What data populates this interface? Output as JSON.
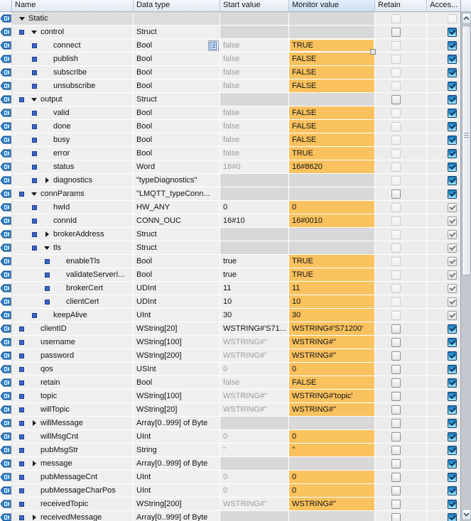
{
  "columns": {
    "name": "Name",
    "data_type": "Data type",
    "start_value": "Start value",
    "monitor_value": "Monitor value",
    "retain": "Retain",
    "access": "Acces..."
  },
  "colors": {
    "monitor_highlight": "#f9c25e",
    "struct_cell_grey": "#d8d8d8",
    "row_bg": "#efefef",
    "static_row_bg": "#dcdcdc",
    "header_bg": "#e9eff7",
    "monitor_header_bg": "#d3e2f4",
    "access_checkbox_blue": "#41a9e0",
    "bullet_blue": "#3a64c8",
    "dim_text": "#9c9c9c"
  },
  "icons": {
    "row_icon": "db-variable-tag-icon",
    "type_button_icon": "list-picker-icon",
    "expander_open": "triangle-down",
    "expander_closed": "triangle-right"
  },
  "rows": [
    {
      "name": "Static",
      "level": 0,
      "bullet": false,
      "expander": "down",
      "type": "",
      "start": null,
      "start_grey": false,
      "monitor": null,
      "retain": "disabled",
      "access": "none",
      "static_row": true,
      "selected": false,
      "type_button": false
    },
    {
      "name": "control",
      "level": 1,
      "bullet": true,
      "expander": "down",
      "type": "Struct",
      "start": null,
      "start_grey": false,
      "monitor": null,
      "retain": "enabled",
      "access": "blue",
      "static_row": false,
      "selected": false,
      "type_button": false
    },
    {
      "name": "connect",
      "level": 2,
      "bullet": true,
      "expander": null,
      "type": "Bool",
      "start": "false",
      "start_grey": true,
      "monitor": "TRUE",
      "retain": "disabled",
      "access": "blue",
      "static_row": false,
      "selected": true,
      "type_button": true
    },
    {
      "name": "publish",
      "level": 2,
      "bullet": true,
      "expander": null,
      "type": "Bool",
      "start": "false",
      "start_grey": true,
      "monitor": "FALSE",
      "retain": "disabled",
      "access": "blue",
      "static_row": false,
      "selected": false,
      "type_button": false
    },
    {
      "name": "subscribe",
      "level": 2,
      "bullet": true,
      "expander": null,
      "type": "Bool",
      "start": "false",
      "start_grey": true,
      "monitor": "FALSE",
      "retain": "disabled",
      "access": "blue",
      "static_row": false,
      "selected": false,
      "type_button": false
    },
    {
      "name": "unsubscribe",
      "level": 2,
      "bullet": true,
      "expander": null,
      "type": "Bool",
      "start": "false",
      "start_grey": true,
      "monitor": "FALSE",
      "retain": "disabled",
      "access": "blue",
      "static_row": false,
      "selected": false,
      "type_button": false
    },
    {
      "name": "output",
      "level": 1,
      "bullet": true,
      "expander": "down",
      "type": "Struct",
      "start": null,
      "start_grey": false,
      "monitor": null,
      "retain": "enabled",
      "access": "blue",
      "static_row": false,
      "selected": false,
      "type_button": false
    },
    {
      "name": "valid",
      "level": 2,
      "bullet": true,
      "expander": null,
      "type": "Bool",
      "start": "false",
      "start_grey": true,
      "monitor": "FALSE",
      "retain": "disabled",
      "access": "blue",
      "static_row": false,
      "selected": false,
      "type_button": false
    },
    {
      "name": "done",
      "level": 2,
      "bullet": true,
      "expander": null,
      "type": "Bool",
      "start": "false",
      "start_grey": true,
      "monitor": "FALSE",
      "retain": "disabled",
      "access": "blue",
      "static_row": false,
      "selected": false,
      "type_button": false
    },
    {
      "name": "busy",
      "level": 2,
      "bullet": true,
      "expander": null,
      "type": "Bool",
      "start": "false",
      "start_grey": true,
      "monitor": "FALSE",
      "retain": "disabled",
      "access": "blue",
      "static_row": false,
      "selected": false,
      "type_button": false
    },
    {
      "name": "error",
      "level": 2,
      "bullet": true,
      "expander": null,
      "type": "Bool",
      "start": "false",
      "start_grey": true,
      "monitor": "TRUE",
      "retain": "disabled",
      "access": "blue",
      "static_row": false,
      "selected": false,
      "type_button": false
    },
    {
      "name": "status",
      "level": 2,
      "bullet": true,
      "expander": null,
      "type": "Word",
      "start": "16#0",
      "start_grey": true,
      "monitor": "16#8620",
      "retain": "disabled",
      "access": "blue",
      "static_row": false,
      "selected": false,
      "type_button": false
    },
    {
      "name": "diagnostics",
      "level": 2,
      "bullet": true,
      "expander": "right",
      "type": "\"typeDiagnostics\"",
      "start": null,
      "start_grey": false,
      "monitor": null,
      "retain": "disabled",
      "access": "blue",
      "static_row": false,
      "selected": false,
      "type_button": false
    },
    {
      "name": "connParams",
      "level": 1,
      "bullet": true,
      "expander": "down",
      "type": "\"LMQTT_typeConn...",
      "start": null,
      "start_grey": false,
      "monitor": null,
      "retain": "enabled",
      "access": "blue",
      "static_row": false,
      "selected": false,
      "type_button": false
    },
    {
      "name": "hwId",
      "level": 2,
      "bullet": true,
      "expander": null,
      "type": "HW_ANY",
      "start": "0",
      "start_grey": false,
      "monitor": "0",
      "retain": "disabled",
      "access": "grey",
      "static_row": false,
      "selected": false,
      "type_button": false
    },
    {
      "name": "connId",
      "level": 2,
      "bullet": true,
      "expander": null,
      "type": "CONN_OUC",
      "start": "16#10",
      "start_grey": false,
      "monitor": "16#0010",
      "retain": "disabled",
      "access": "grey",
      "static_row": false,
      "selected": false,
      "type_button": false
    },
    {
      "name": "brokerAddress",
      "level": 2,
      "bullet": true,
      "expander": "right",
      "type": "Struct",
      "start": null,
      "start_grey": false,
      "monitor": null,
      "retain": "disabled",
      "access": "grey",
      "static_row": false,
      "selected": false,
      "type_button": false
    },
    {
      "name": "tls",
      "level": 2,
      "bullet": true,
      "expander": "down",
      "type": "Struct",
      "start": null,
      "start_grey": false,
      "monitor": null,
      "retain": "disabled",
      "access": "grey",
      "static_row": false,
      "selected": false,
      "type_button": false
    },
    {
      "name": "enableTls",
      "level": 3,
      "bullet": true,
      "expander": null,
      "type": "Bool",
      "start": "true",
      "start_grey": false,
      "monitor": "TRUE",
      "retain": "disabled",
      "access": "grey",
      "static_row": false,
      "selected": false,
      "type_button": false
    },
    {
      "name": "validateServerI...",
      "level": 3,
      "bullet": true,
      "expander": null,
      "type": "Bool",
      "start": "true",
      "start_grey": false,
      "monitor": "TRUE",
      "retain": "disabled",
      "access": "grey",
      "static_row": false,
      "selected": false,
      "type_button": false
    },
    {
      "name": "brokerCert",
      "level": 3,
      "bullet": true,
      "expander": null,
      "type": "UDInt",
      "start": "11",
      "start_grey": false,
      "monitor": "11",
      "retain": "disabled",
      "access": "grey",
      "static_row": false,
      "selected": false,
      "type_button": false
    },
    {
      "name": "clientCert",
      "level": 3,
      "bullet": true,
      "expander": null,
      "type": "UDInt",
      "start": "10",
      "start_grey": false,
      "monitor": "10",
      "retain": "disabled",
      "access": "grey",
      "static_row": false,
      "selected": false,
      "type_button": false
    },
    {
      "name": "keepAlive",
      "level": 2,
      "bullet": true,
      "expander": null,
      "type": "UInt",
      "start": "30",
      "start_grey": false,
      "monitor": "30",
      "retain": "disabled",
      "access": "grey",
      "static_row": false,
      "selected": false,
      "type_button": false
    },
    {
      "name": "clientID",
      "level": 1,
      "bullet": true,
      "expander": null,
      "type": "WString[20]",
      "start": "WSTRING#'S71...",
      "start_grey": false,
      "monitor": "WSTRING#'S71200'",
      "retain": "enabled",
      "access": "blue",
      "static_row": false,
      "selected": false,
      "type_button": false
    },
    {
      "name": "username",
      "level": 1,
      "bullet": true,
      "expander": null,
      "type": "WString[100]",
      "start": "WSTRING#''",
      "start_grey": true,
      "monitor": "WSTRING#''",
      "retain": "enabled",
      "access": "blue",
      "static_row": false,
      "selected": false,
      "type_button": false
    },
    {
      "name": "password",
      "level": 1,
      "bullet": true,
      "expander": null,
      "type": "WString[200]",
      "start": "WSTRING#''",
      "start_grey": true,
      "monitor": "WSTRING#''",
      "retain": "enabled",
      "access": "blue",
      "static_row": false,
      "selected": false,
      "type_button": false
    },
    {
      "name": "qos",
      "level": 1,
      "bullet": true,
      "expander": null,
      "type": "USInt",
      "start": "0",
      "start_grey": true,
      "monitor": "0",
      "retain": "enabled",
      "access": "blue",
      "static_row": false,
      "selected": false,
      "type_button": false
    },
    {
      "name": "retain",
      "level": 1,
      "bullet": true,
      "expander": null,
      "type": "Bool",
      "start": "false",
      "start_grey": true,
      "monitor": "FALSE",
      "retain": "enabled",
      "access": "blue",
      "static_row": false,
      "selected": false,
      "type_button": false
    },
    {
      "name": "topic",
      "level": 1,
      "bullet": true,
      "expander": null,
      "type": "WString[100]",
      "start": "WSTRING#''",
      "start_grey": true,
      "monitor": "WSTRING#'topic'",
      "retain": "enabled",
      "access": "blue",
      "static_row": false,
      "selected": false,
      "type_button": false
    },
    {
      "name": "willTopic",
      "level": 1,
      "bullet": true,
      "expander": null,
      "type": "WString[20]",
      "start": "WSTRING#''",
      "start_grey": true,
      "monitor": "WSTRING#''",
      "retain": "enabled",
      "access": "blue",
      "static_row": false,
      "selected": false,
      "type_button": false
    },
    {
      "name": "willMessage",
      "level": 1,
      "bullet": true,
      "expander": "right",
      "type": "Array[0..999] of Byte",
      "start": null,
      "start_grey": false,
      "monitor": null,
      "retain": "enabled",
      "access": "blue",
      "static_row": false,
      "selected": false,
      "type_button": false
    },
    {
      "name": "willMsgCnt",
      "level": 1,
      "bullet": true,
      "expander": null,
      "type": "UInt",
      "start": "0",
      "start_grey": true,
      "monitor": "0",
      "retain": "enabled",
      "access": "blue",
      "static_row": false,
      "selected": false,
      "type_button": false
    },
    {
      "name": "pubMsgStr",
      "level": 1,
      "bullet": true,
      "expander": null,
      "type": "String",
      "start": "''",
      "start_grey": true,
      "monitor": "''",
      "retain": "enabled",
      "access": "blue",
      "static_row": false,
      "selected": false,
      "type_button": false
    },
    {
      "name": "message",
      "level": 1,
      "bullet": true,
      "expander": "right",
      "type": "Array[0..999] of Byte",
      "start": null,
      "start_grey": false,
      "monitor": null,
      "retain": "enabled",
      "access": "blue",
      "static_row": false,
      "selected": false,
      "type_button": false
    },
    {
      "name": "pubMessageCnt",
      "level": 1,
      "bullet": true,
      "expander": null,
      "type": "UInt",
      "start": "0",
      "start_grey": true,
      "monitor": "0",
      "retain": "enabled",
      "access": "blue",
      "static_row": false,
      "selected": false,
      "type_button": false
    },
    {
      "name": "pubMessageCharPos",
      "level": 1,
      "bullet": true,
      "expander": null,
      "type": "UInt",
      "start": "0",
      "start_grey": true,
      "monitor": "0",
      "retain": "enabled",
      "access": "blue",
      "static_row": false,
      "selected": false,
      "type_button": false
    },
    {
      "name": "receivedTopic",
      "level": 1,
      "bullet": true,
      "expander": null,
      "type": "WString[200]",
      "start": "WSTRING#''",
      "start_grey": true,
      "monitor": "WSTRING#''",
      "retain": "enabled",
      "access": "blue",
      "static_row": false,
      "selected": false,
      "type_button": false
    },
    {
      "name": "receivedMessage",
      "level": 1,
      "bullet": true,
      "expander": "right",
      "type": "Array[0..999] of Byte",
      "start": null,
      "start_grey": false,
      "monitor": null,
      "retain": "enabled",
      "access": "blue",
      "static_row": false,
      "selected": false,
      "type_button": false
    }
  ]
}
